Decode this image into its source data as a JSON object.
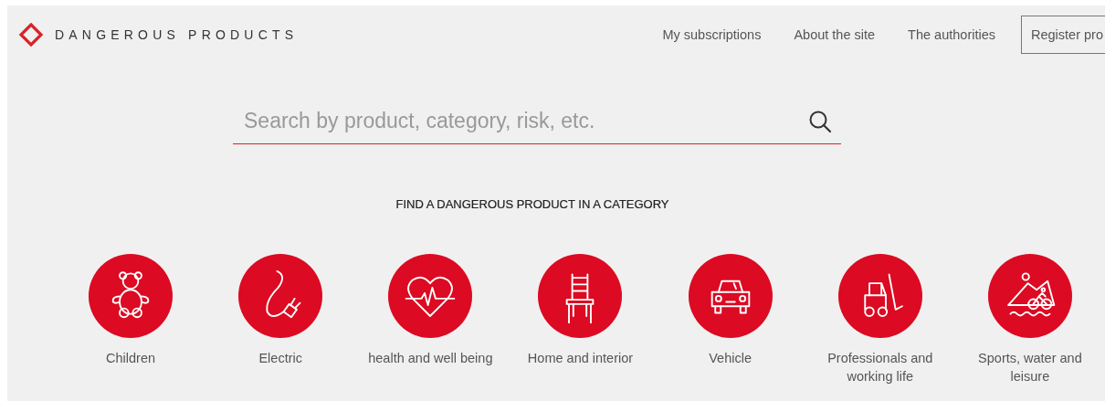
{
  "header": {
    "logo_text": "DANGEROUS PRODUCTS",
    "nav": [
      {
        "label": "My subscriptions"
      },
      {
        "label": "About the site"
      },
      {
        "label": "The authorities"
      }
    ],
    "register_button": "Register pro"
  },
  "search": {
    "placeholder": "Search by product, category, risk, etc."
  },
  "categories_heading": "FIND A DANGEROUS PRODUCT IN A CATEGORY",
  "categories": [
    {
      "label": "Children"
    },
    {
      "label": "Electric"
    },
    {
      "label": "health and well being"
    },
    {
      "label": "Home and interior"
    },
    {
      "label": "Vehicle"
    },
    {
      "label": "Professionals and working life"
    },
    {
      "label": "Sports, water and leisure"
    }
  ]
}
